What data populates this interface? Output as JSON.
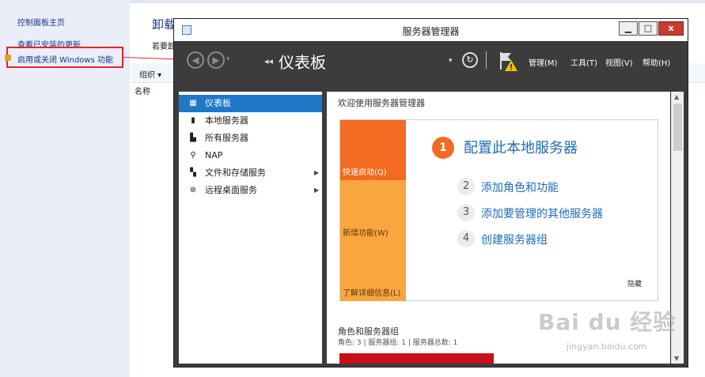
{
  "control_panel": {
    "home_link": "控制面板主页",
    "updates_link": "查看已安装的更新",
    "features_link": "启用或关闭 Windows 功能",
    "main_title": "卸载",
    "main_subtitle": "若要卸",
    "toolbar_org": "组织 ▾",
    "column_name": "名称"
  },
  "window": {
    "title": "服务器管理器",
    "min_glyph": "▁",
    "max_glyph": "□",
    "close_glyph": "x"
  },
  "nav": {
    "back_glyph": "◀",
    "forward_glyph": "▶",
    "dropdown_glyph": "▾",
    "crumb_arrows": "◂◂",
    "breadcrumb": "仪表板",
    "refresh_glyph": "↻",
    "menus": [
      "管理(M)",
      "工具(T)",
      "视图(V)",
      "帮助(H)"
    ]
  },
  "sidebar": {
    "items": [
      {
        "label": "仪表板",
        "icon": "dashboard-icon"
      },
      {
        "label": "本地服务器",
        "icon": "server-icon"
      },
      {
        "label": "所有服务器",
        "icon": "servers-icon"
      },
      {
        "label": "NAP",
        "icon": "nap-icon"
      },
      {
        "label": "文件和存储服务",
        "icon": "storage-icon",
        "chevron": "▶"
      },
      {
        "label": "远程桌面服务",
        "icon": "remote-desktop-icon",
        "chevron": "▶"
      }
    ]
  },
  "content": {
    "welcome": "欢迎使用服务器管理器",
    "tile_segments": [
      "快速启动(Q)",
      "新增功能(W)",
      "了解详细信息(L)"
    ],
    "step1_num": "1",
    "step1": "配置此本地服务器",
    "steps": [
      {
        "num": "2",
        "label": "添加角色和功能"
      },
      {
        "num": "3",
        "label": "添加要管理的其他服务器"
      },
      {
        "num": "4",
        "label": "创建服务器组"
      }
    ],
    "hide": "隐藏",
    "roles_title": "角色和服务器组",
    "roles_sub": "角色: 3 | 服务器组: 1 | 服务器总数: 1"
  },
  "watermark": {
    "brand": "Bai du 经验",
    "url": "jingyan.baidu.com"
  },
  "colors": {
    "accent": "#1e78c8",
    "quick_start": "#f26b20",
    "secondary_tile": "#f9a540",
    "nav_bg": "#3c3c3c",
    "highlight_box": "#e8232a"
  }
}
